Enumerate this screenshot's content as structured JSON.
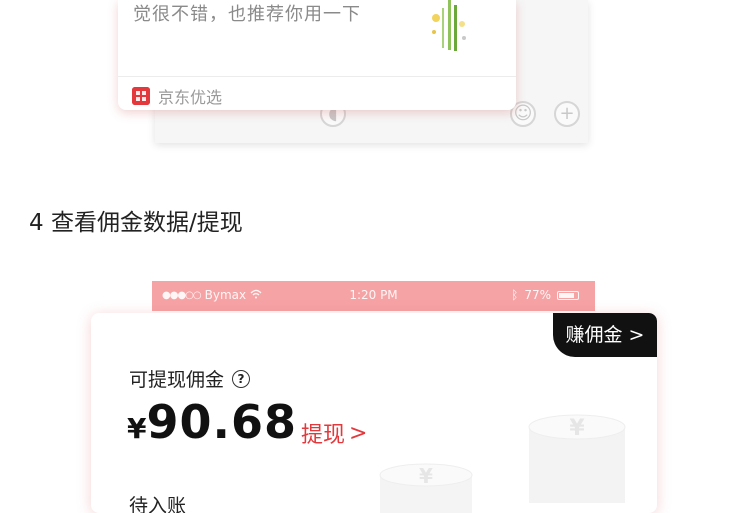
{
  "share_card": {
    "text": "觉很不错，也推荐你用一下",
    "source_label": "京东优选",
    "logo_text": "京东优选"
  },
  "section": {
    "heading": "4 查看佣金数据/提现"
  },
  "status_bar": {
    "carrier": "Bymax",
    "time": "1:20 PM",
    "battery": "77%"
  },
  "commission": {
    "earn_button": "赚佣金 >",
    "label": "可提现佣金",
    "help_glyph": "?",
    "currency": "¥",
    "amount": "90.68",
    "withdraw_label": "提现",
    "withdraw_chevron": ">",
    "next_label": "待入账"
  },
  "colors": {
    "accent": "#e4393c",
    "status_bar": "#f6a3a5",
    "dark": "#111111"
  }
}
